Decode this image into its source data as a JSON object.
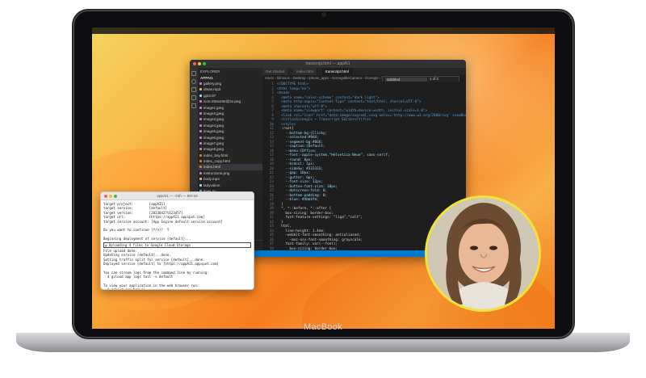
{
  "device": {
    "brand": "MacBook"
  },
  "vscode": {
    "window_title": "transcript.html — appAI1",
    "tabs": [
      "Get Started",
      "index.html",
      "transcript.html"
    ],
    "breadcrumbs": "Users › bilnovus › Desktop › Iphone_apps › ScreegableCamera › Screegle › website › transcript.html › html › head › style",
    "explorer": {
      "header": "EXPLORER",
      "section": "APPAI1",
      "files": [
        {
          "name": "gallery.png",
          "color": "#c586c0"
        },
        {
          "name": "ideas.mp3",
          "color": "#d7ba7d"
        },
        {
          "name": "gpt4.97",
          "color": "#9cdcfe"
        },
        {
          "name": "icon-256x256@2x.png",
          "color": "#c586c0"
        },
        {
          "name": "image1.jpeg",
          "color": "#c586c0"
        },
        {
          "name": "image2.jpeg",
          "color": "#c586c0"
        },
        {
          "name": "image3.jpeg",
          "color": "#c586c0"
        },
        {
          "name": "image4.jpeg",
          "color": "#c586c0"
        },
        {
          "name": "image5.jpeg",
          "color": "#c586c0"
        },
        {
          "name": "image6.jpeg",
          "color": "#c586c0"
        },
        {
          "name": "image7.jpeg",
          "color": "#c586c0"
        },
        {
          "name": "image8.jpeg",
          "color": "#c586c0"
        },
        {
          "name": "index_bsy.html",
          "color": "#e37933"
        },
        {
          "name": "index_copy.html",
          "color": "#e37933"
        },
        {
          "name": "index.html",
          "color": "#e37933"
        },
        {
          "name": "instructions.png",
          "color": "#c586c0"
        },
        {
          "name": "body.mp4",
          "color": "#d7ba7d"
        },
        {
          "name": "ladyvalion",
          "color": "#9cdcfe"
        },
        {
          "name": "lines.py",
          "color": "#4ec9b0"
        },
        {
          "name": "link.png",
          "color": "#c586c0"
        },
        {
          "name": "lobo2.jpg",
          "color": "#c586c0"
        },
        {
          "name": "mac-365.png",
          "color": "#c586c0"
        },
        {
          "name": "mainspot.jpg",
          "color": "#c586c0"
        },
        {
          "name": "mainmaetimpl.jpg",
          "color": "#c586c0"
        },
        {
          "name": "mainmaetpl2.jpg",
          "color": "#c586c0"
        },
        {
          "name": "maps.mp3",
          "color": "#d7ba7d"
        },
        {
          "name": "meet.jpg",
          "color": "#c586c0"
        },
        {
          "name": "meta.html",
          "color": "#e37933"
        },
        {
          "name": "meta-maker.html",
          "color": "#e37933"
        },
        {
          "name": "meta-screegle-virtual.jpeg",
          "color": "#c586c0"
        },
        {
          "name": "meta-screegle-virtual.jpg",
          "color": "#c586c0"
        }
      ],
      "selected_index": 14,
      "outline": "OUTLINE",
      "timeline": "TIMELINE"
    },
    "find": {
      "query": "subtitled",
      "count": "1 of 3"
    },
    "code_lines": [
      "<!DOCTYPE html>",
      "<html lang=\"en\">",
      "<head>",
      "  <meta name=\"color-scheme\" content=\"dark light\">",
      "  <meta http-equiv=\"Content-Type\" content=\"text/html; charset=UTF-8\">",
      "  <meta charset=\"utf-8\">",
      "  <meta name=\"viewport\" content=\"width=device-width, initial-scale=1.0\">",
      "  <link rel=\"icon\" href=\"data:image/svg+xml,<svg xmlns='http://www.w3.org/2000/svg' viewBox='0 0 100 100'>",
      "  <title>Screegle • Transcript Editor</title>",
      "  <style>",
      "  :root{",
      "    --bottom-bg:{Clicky;",
      "    --selected:#9d4;",
      "    --segment-bg:#666;",
      "    --caption:{Default;",
      "    --menu:{Office;",
      "    --font:-apple-system,\"Helvetica Neue\", sans-serif;",
      "    --round: 8px;",
      "    --brdcol: 1px;",
      "    --sideSw: #333333;",
      "    --gap: 10px;",
      "    --gutter: 6px;",
      "    --font-size: 12px;",
      "    --button-font-size: 10px;",
      "    --dotscreen-fold: 0;",
      "    --bottom-padding: 0;",
      "    --blue: #4bb4fd;",
      "  }",
      "  *, *::before, *::after {",
      "    box-sizing: border-box;",
      "    font-feature-settings: \"liga\",\"calt\";",
      "  }",
      "  html,",
      "    line-height: 1.4em;",
      "    -webkit-font-smoothing: antialiased;",
      "      -moz-osx-font-smoothing: grayscale;",
      "    font-family: var(--font);",
      "      box-sizing: border-box;",
      "  }"
    ],
    "status_left": "⎇ main*  ⊗ 0 ⚠ 0"
  },
  "terminal": {
    "title": "appAI1 — -zsh — 80×24",
    "lines": [
      "target project:        [appAI1]",
      "target service:        [default]",
      "target version:        [20230427t123457]",
      "target url:            [https://appAI1.appspot.com]",
      "target service account: [App Engine default service account]",
      "",
      "Do you want to continue (Y/n)?  Y",
      "",
      "Beginning deployment of service [default]...",
      "BOX:╔ Uploading 4 files to Google Cloud Storage",
      "File upload done.",
      "Updating service [default]...done.",
      "Setting traffic split for service [default]...done.",
      "Deployed service [default] to [https://appAI1.appspot.com]",
      "",
      "You can stream logs from the command line by running:",
      "  $ gcloud app logs tail -s default",
      "",
      "To view your application in the web browser run:",
      "  $ gcloud app browse",
      "(devcoef@Laurents-MBP appAI1 %"
    ]
  },
  "colors": {
    "wallpaper_orange": "#f57b1d",
    "webcam_ring": "#f2e33a",
    "vscode_status": "#007acc"
  }
}
